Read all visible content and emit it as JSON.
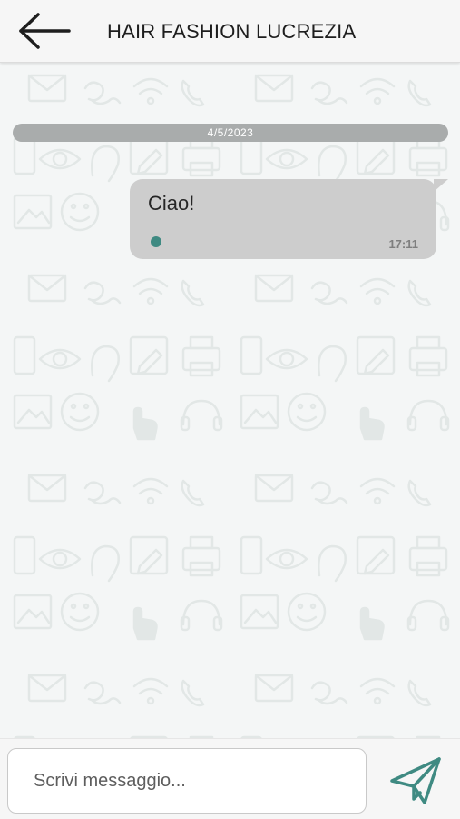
{
  "header": {
    "title": "HAIR FASHION LUCREZIA",
    "back_icon": "arrow-left-icon"
  },
  "chat": {
    "date_separator": "4/5/2023",
    "messages": [
      {
        "text": "Ciao!",
        "time": "17:11",
        "status_color": "#3f8a82"
      }
    ]
  },
  "composer": {
    "placeholder": "Scrivi messaggio...",
    "value": "",
    "send_icon": "paper-plane-icon",
    "accent_color": "#3f8a82"
  },
  "background": {
    "pattern_icons": [
      "envelope-icon",
      "sign-language-icon",
      "wifi-icon",
      "phone-icon",
      "eye-icon",
      "pencil-icon",
      "printer-icon",
      "smartphone-icon",
      "ear-icon",
      "image-icon",
      "smiley-icon",
      "hand-pointer-icon",
      "headphones-icon"
    ]
  }
}
